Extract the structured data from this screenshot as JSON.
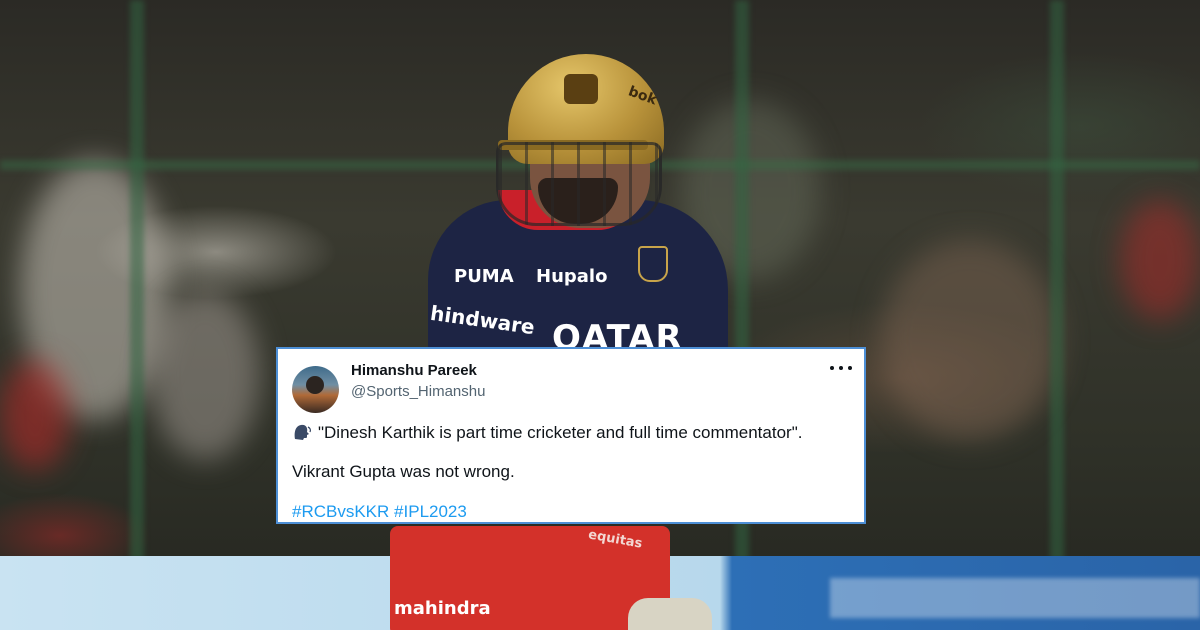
{
  "photo": {
    "jersey": {
      "sponsor": "QATAR",
      "left_sleeve": "hindware",
      "chest": "Hupalo",
      "puma": "PUMA",
      "shorts": "mahindra",
      "shorts_right": "equitas",
      "helmet": "bok"
    }
  },
  "tweet": {
    "author_name": "Himanshu Pareek",
    "author_handle": "@Sports_Himanshu",
    "quote_text": "\"Dinesh Karthik is part time cricketer and full time commentator\".",
    "body_text": "Vikrant Gupta was not wrong.",
    "hashtags": [
      "#RCBvsKKR",
      "#IPL2023"
    ],
    "link_color": "#1d9bf0",
    "border_color": "#4d8fd6",
    "more_icon": "more-horizontal-icon",
    "emoji_icon": "speaking-head-icon"
  }
}
